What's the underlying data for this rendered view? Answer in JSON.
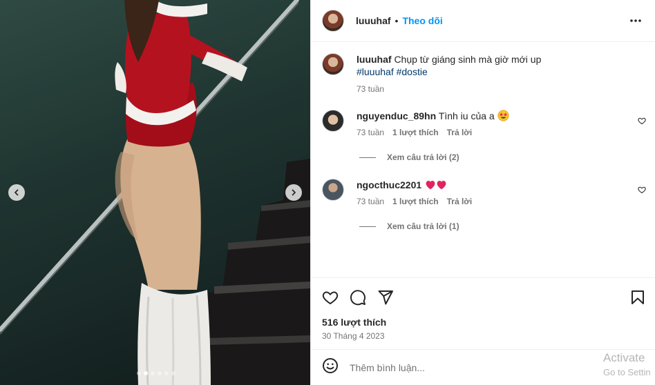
{
  "post": {
    "username": "luuuhaf",
    "separator": "•",
    "follow_label": "Theo dõi",
    "more_icon": "more-horizontal-icon",
    "caption": {
      "username": "luuuhaf",
      "text": "Chụp từ giáng sinh mà giờ mới up",
      "hashtags": "#luuuhaf #dostie",
      "time": "73 tuần"
    },
    "comments": [
      {
        "username": "nguyenduc_89hn",
        "text": "Tình iu của a",
        "emoji": "star-struck-emoji",
        "time": "73 tuần",
        "likes": "1 lượt thích",
        "reply_label": "Trả lời",
        "view_replies": "Xem câu trả lời (2)"
      },
      {
        "username": "ngocthuc2201",
        "text": "",
        "emoji": "two-red-hearts-emoji",
        "time": "73 tuần",
        "likes": "1 lượt thích",
        "reply_label": "Trả lời",
        "view_replies": "Xem câu trả lời (1)"
      }
    ],
    "likes_count": "516 lượt thích",
    "date": "30 Tháng 4 2023",
    "add_comment_placeholder": "Thêm bình luận...",
    "carousel": {
      "total": 6,
      "active_index": 1
    }
  },
  "os_watermark": {
    "line1": "Activate",
    "line2": "Go to Settin"
  },
  "colors": {
    "accent": "#0095f6",
    "hashtag": "#00376b",
    "secondary_text": "#737373",
    "heart": "#e0245e"
  }
}
